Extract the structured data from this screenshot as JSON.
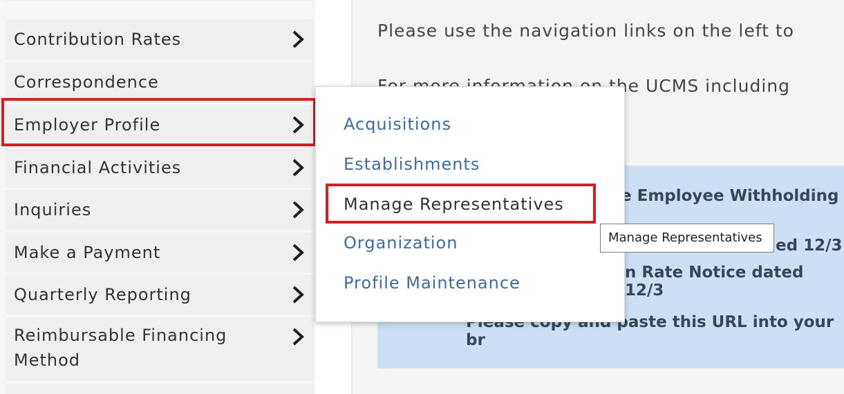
{
  "sidebar": {
    "items": [
      {
        "label": "Contribution Rates",
        "has_arrow": true
      },
      {
        "label": "Correspondence",
        "has_arrow": false
      },
      {
        "label": "Employer Profile",
        "has_arrow": true
      },
      {
        "label": "Financial Activities",
        "has_arrow": true
      },
      {
        "label": "Inquiries",
        "has_arrow": true
      },
      {
        "label": "Make a Payment",
        "has_arrow": true
      },
      {
        "label": "Quarterly Reporting",
        "has_arrow": true
      },
      {
        "label": "Reimbursable Financing Method",
        "has_arrow": true
      }
    ]
  },
  "main": {
    "intro_line": "Please use the navigation links on the left to",
    "info_line": "For more information on the UCMS including",
    "notice_line1": "e Employee Withholding",
    "notice_line2": "ed 12/3",
    "notice_line3": "n Rate Notice dated 12/3",
    "notice_line4": "Please copy and paste this URL into your br"
  },
  "flyout": {
    "items": [
      {
        "label": "Acquisitions"
      },
      {
        "label": "Establishments"
      },
      {
        "label": "Manage Representatives"
      },
      {
        "label": "Organization"
      },
      {
        "label": "Profile Maintenance"
      }
    ]
  },
  "tooltip": {
    "text": "Manage Representatives"
  },
  "colors": {
    "highlight_border": "#d31f26",
    "link": "#3f6c9e",
    "notice_bg": "#cde0f3"
  }
}
